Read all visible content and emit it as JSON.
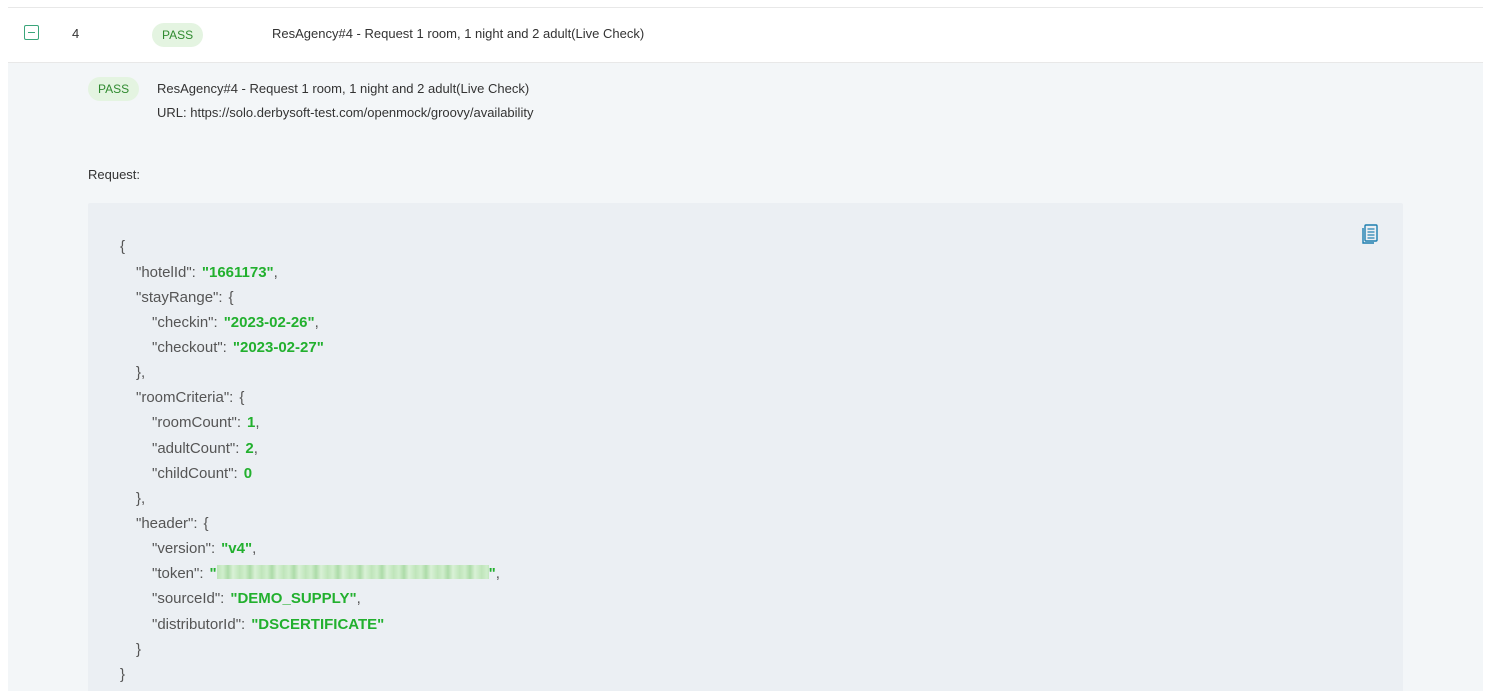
{
  "row": {
    "index": "4",
    "status": "PASS",
    "title": "ResAgency#4 - Request 1 room, 1 night and 2 adult(Live Check)"
  },
  "detail": {
    "status": "PASS",
    "title": "ResAgency#4 - Request 1 room, 1 night and 2 adult(Live Check)",
    "url": "URL: https://solo.derbysoft-test.com/openmock/groovy/availability",
    "request_label": "Request:"
  },
  "request_json": {
    "open_brace": "{",
    "hotelId_key": "\"hotelId\":",
    "hotelId_val": "\"1661173\"",
    "stayRange_key": "\"stayRange\":",
    "checkin_key": "\"checkin\":",
    "checkin_val": "\"2023-02-26\"",
    "checkout_key": "\"checkout\":",
    "checkout_val": "\"2023-02-27\"",
    "roomCriteria_key": "\"roomCriteria\":",
    "roomCount_key": "\"roomCount\":",
    "roomCount_val": "1",
    "adultCount_key": "\"adultCount\":",
    "adultCount_val": "2",
    "childCount_key": "\"childCount\":",
    "childCount_val": "0",
    "header_key": "\"header\":",
    "version_key": "\"version\":",
    "version_val": "\"v4\"",
    "token_key": "\"token\":",
    "token_quote_open": "\"",
    "token_quote_close": "\"",
    "sourceId_key": "\"sourceId\":",
    "sourceId_val": "\"DEMO_SUPPLY\"",
    "distributorId_key": "\"distributorId\":",
    "distributorId_val": "\"DSCERTIFICATE\"",
    "close_brace": "}",
    "close_brace_comma": "},",
    "open_brace_inline": "{",
    "comma": ","
  },
  "icons": {
    "collapse": "minus-square-icon",
    "copy": "copy-icon"
  },
  "colors": {
    "accent": "#3aa57a",
    "badge_bg": "#e4f4e1",
    "badge_text": "#2f8a2f",
    "json_value": "#22b02e",
    "panel_bg": "#f3f6f8",
    "code_bg": "#ebeff3"
  }
}
